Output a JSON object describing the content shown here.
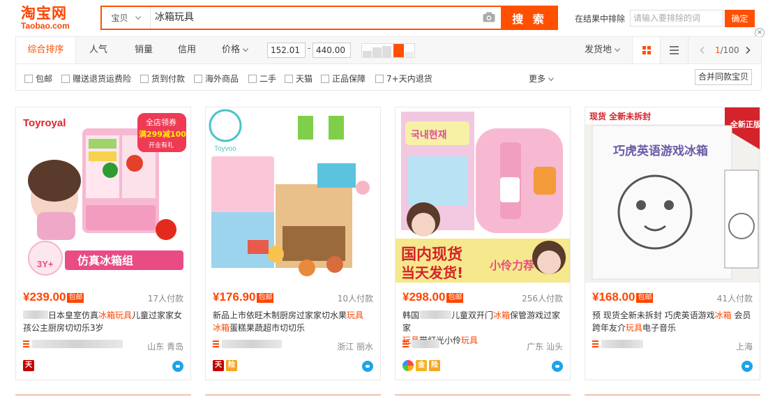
{
  "header": {
    "logo_cn": "淘宝网",
    "logo_en": "Taobao.com",
    "search_scope": "宝贝",
    "search_value": "冰箱玩具",
    "search_button": "搜 索",
    "exclude_label": "在结果中排除",
    "exclude_placeholder": "请输入要排除的词",
    "confirm_button": "确定",
    "close": "×"
  },
  "sortbar": {
    "items": [
      "综合排序",
      "人气",
      "销量",
      "信用",
      "价格"
    ],
    "price_min": "152.01",
    "price_dash": "-",
    "price_max": "440.00",
    "location": "发货地",
    "page": "1/100",
    "page_current": "1",
    "page_total": "/100"
  },
  "filters": {
    "items": [
      "包邮",
      "赠送退货运费险",
      "货到付款",
      "海外商品",
      "二手",
      "天猫",
      "正品保障",
      "7+天内退货"
    ],
    "more": "更多",
    "merge_button": "合并同款宝贝"
  },
  "colors": {
    "accent": "#ff5000",
    "price": "#ff4400"
  },
  "products": [
    {
      "price": "¥239.00",
      "baoyou": "包邮",
      "buyers": "17人付款",
      "title_parts": [
        "日本皇室仿真",
        "冰箱玩具",
        "儿童过家家女孩公主厨房切切乐3岁"
      ],
      "location": "山东 青岛",
      "image_text": [
        "全店领券",
        "满299减100",
        "开业有礼",
        "Toyroyal",
        "仿真冰箱组",
        "3Y+"
      ],
      "badges": [
        "tmall-icon"
      ]
    },
    {
      "price": "¥176.90",
      "baoyou": "包邮",
      "buyers": "10人付款",
      "title_parts": [
        "新品上市依旺木制厨房过家家切水果",
        "玩具",
        "冰箱",
        "蛋糕果蔬超市切切乐"
      ],
      "location": "浙江 丽水",
      "image_text": [
        "Toyvoo"
      ],
      "badges": [
        "tmall-icon",
        "insurance-icon"
      ]
    },
    {
      "price": "¥298.00",
      "baoyou": "包邮",
      "buyers": "256人付款",
      "title_parts": [
        "韩国",
        "儿童双开门",
        "冰箱",
        "保管游戏过家家",
        "玩具",
        "带灯光小伶",
        "玩具"
      ],
      "location": "广东 汕头",
      "image_text": [
        "국내현재",
        "国内现货",
        "当天发货!",
        "小伶力荐"
      ],
      "badges": [
        "brand-icon",
        "gold-icon",
        "insurance-icon"
      ]
    },
    {
      "price": "¥168.00",
      "baoyou": "包邮",
      "buyers": "41人付款",
      "title_parts": [
        "预 现货全新未拆封 巧虎英语游戏",
        "冰箱",
        " 会员跨年友介",
        "玩具",
        "电子音乐"
      ],
      "location": "上海",
      "image_text": [
        "现货 全新未拆封",
        "全新正版",
        "巧虎英语游戏冰箱"
      ],
      "badges": []
    }
  ]
}
